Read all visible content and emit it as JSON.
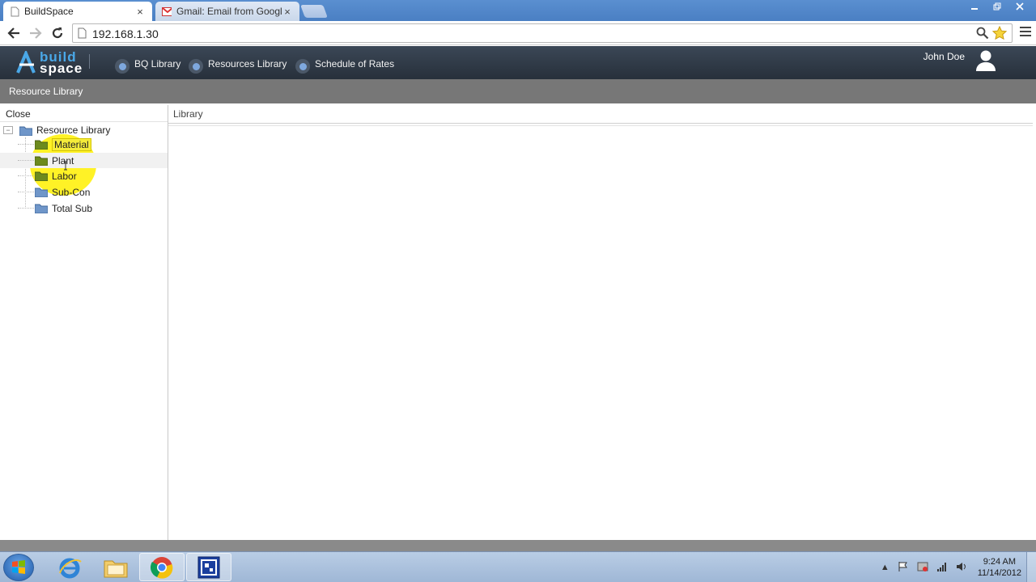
{
  "browser": {
    "tabs": [
      {
        "label": "BuildSpace",
        "close": "×"
      },
      {
        "label": "Gmail: Email from Google",
        "close": "×"
      }
    ],
    "url": "192.168.1.30"
  },
  "header": {
    "logo_word1": "build",
    "logo_word2": "space",
    "nav": [
      {
        "label": "BQ Library"
      },
      {
        "label": "Resources Library"
      },
      {
        "label": "Schedule of Rates"
      }
    ],
    "user_name": "John Doe"
  },
  "page": {
    "title": "Resource Library",
    "close_label": "Close",
    "library_header": "Library"
  },
  "tree": {
    "root": "Resource Library",
    "items": [
      {
        "label": "Material"
      },
      {
        "label": "Plant"
      },
      {
        "label": "Labor"
      },
      {
        "label": "Sub-Con"
      },
      {
        "label": "Total Sub"
      }
    ]
  },
  "taskbar": {
    "time": "9:24 AM",
    "date": "11/14/2012"
  },
  "colors": {
    "app_header": "#2f3a47",
    "title_bar": "#777777",
    "folder_blue": "#6f96c9",
    "folder_green": "#6c8a1e",
    "highlight": "#fff000",
    "logo_accent": "#4aa8e8"
  }
}
